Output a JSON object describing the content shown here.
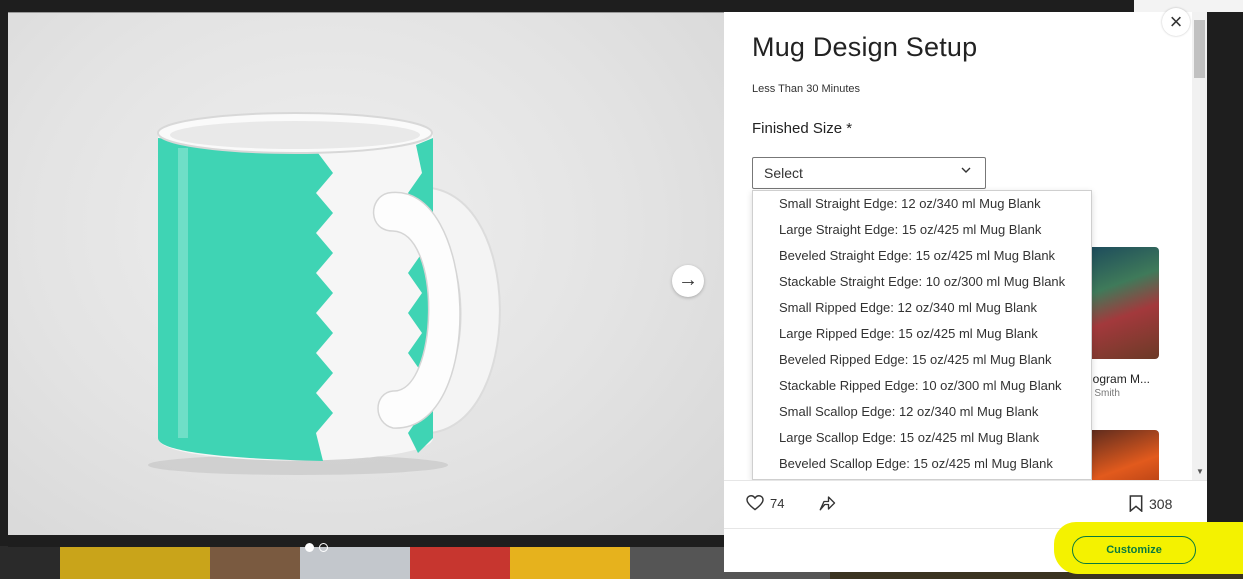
{
  "project": {
    "title": "Mug Design Setup",
    "duration": "Less Than 30 Minutes",
    "size_label": "Finished Size *",
    "select_value": "Select"
  },
  "size_options": [
    "Small Straight Edge: 12 oz/340 ml Mug Blank",
    "Large Straight Edge: 15 oz/425 ml Mug Blank",
    "Beveled Straight Edge: 15 oz/425 ml Mug Blank",
    "Stackable Straight Edge: 10 oz/300 ml Mug Blank",
    "Small Ripped Edge: 12 oz/340 ml Mug Blank",
    "Large Ripped Edge: 15 oz/425 ml Mug Blank",
    "Beveled Ripped Edge: 15 oz/425 ml Mug Blank",
    "Stackable Ripped Edge: 10 oz/300 ml Mug Blank",
    "Small Scallop Edge: 12 oz/340 ml Mug Blank",
    "Large Scallop Edge: 15 oz/425 ml Mug Blank",
    "Beveled Scallop Edge: 15 oz/425 ml Mug Blank"
  ],
  "related_card": {
    "title": "nogram M...",
    "author": "e Smith"
  },
  "actions": {
    "likes": "74",
    "saves": "308"
  },
  "footer": {
    "customize_label": "Customize"
  },
  "icons": {
    "close": "×",
    "next": "→"
  },
  "colors": {
    "mug_accent": "#3fd4b4",
    "button_green": "#0a7a3e",
    "highlight": "#f4f200"
  }
}
